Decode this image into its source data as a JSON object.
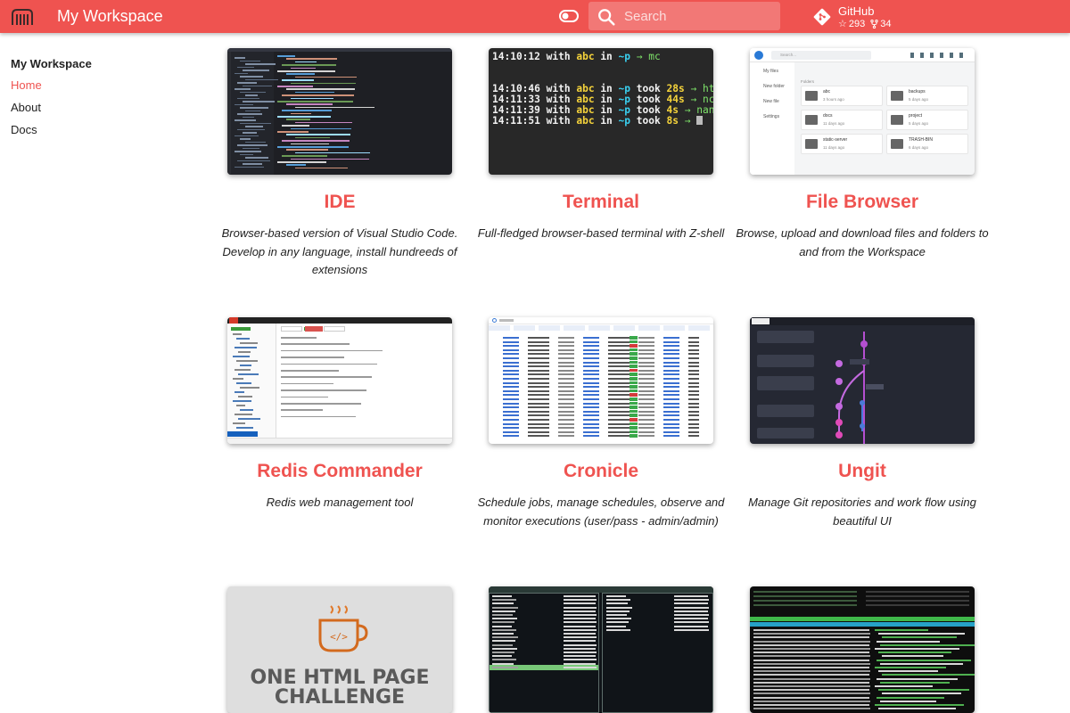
{
  "header": {
    "title": "My Workspace",
    "search_placeholder": "Search",
    "github": {
      "label": "GitHub",
      "stars": "293",
      "forks": "34"
    },
    "colors": {
      "brand": "#ef5350"
    }
  },
  "sidebar": {
    "heading": "My Workspace",
    "items": [
      {
        "label": "Home",
        "active": true
      },
      {
        "label": "About",
        "active": false
      },
      {
        "label": "Docs",
        "active": false
      }
    ]
  },
  "cards": [
    {
      "title": "IDE",
      "description": "Browser-based version of Visual Studio Code. Develop in any language, install hundreeds of extensions"
    },
    {
      "title": "Terminal",
      "description": "Full-fledged browser-based terminal with Z-shell",
      "screen_lines": [
        {
          "time": "14:10:12",
          "took": "",
          "cmd": "mc"
        },
        {
          "time": "14:10:46",
          "took": "28s",
          "cmd": "htop"
        },
        {
          "time": "14:11:33",
          "took": "44s",
          "cmd": "ncdu"
        },
        {
          "time": "14:11:39",
          "took": "4s",
          "cmd": "nano"
        },
        {
          "time": "14:11:51",
          "took": "8s",
          "cmd": ""
        }
      ]
    },
    {
      "title": "File Browser",
      "description": "Browse, upload and download files and folders to and from the Workspace",
      "screen": {
        "search": "Search...",
        "nav": [
          "My files",
          "New folder",
          "New file",
          "Settings"
        ],
        "section": "Folders",
        "folders": [
          {
            "name": "abc",
            "age": "3 hours ago"
          },
          {
            "name": "backups",
            "age": "5 days ago"
          },
          {
            "name": "docs",
            "age": "11 days ago"
          },
          {
            "name": "project",
            "age": "5 days ago"
          },
          {
            "name": "static-server",
            "age": "11 days ago"
          },
          {
            "name": "TRASH-BIN",
            "age": "6 days ago"
          }
        ]
      }
    },
    {
      "title": "Redis Commander",
      "description": "Redis web management tool"
    },
    {
      "title": "Cronicle",
      "description": "Schedule jobs, manage schedules, observe and monitor executions (user/pass - admin/admin)"
    },
    {
      "title": "Ungit",
      "description": "Manage Git repositories and work flow using beautiful UI"
    },
    {
      "title": "",
      "description": "",
      "screen": {
        "line1": "ONE HTML PAGE",
        "line2": "CHALLENGE"
      }
    },
    {
      "title": "",
      "description": ""
    },
    {
      "title": "",
      "description": ""
    }
  ]
}
